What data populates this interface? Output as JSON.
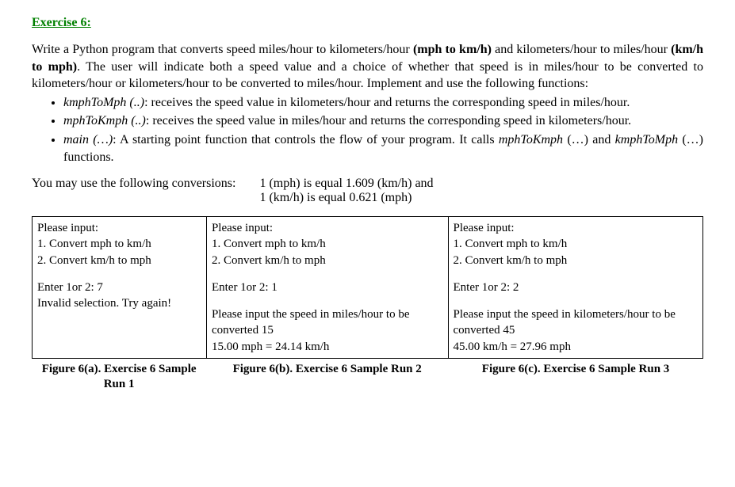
{
  "title": "Exercise 6:",
  "intro_part1": "Write a Python program that converts speed miles/hour to kilometers/hour ",
  "intro_bold1": "(mph to km/h)",
  "intro_part2": " and kilometers/hour to miles/hour ",
  "intro_bold2": "(km/h to mph)",
  "intro_part3": ". The user will indicate both a speed value and a choice of whether that speed is in miles/hour to be converted to kilometers/hour or kilometers/hour to be converted to miles/hour. Implement and use the following functions:",
  "bullets": [
    {
      "name": "kmphToMph (..)",
      "desc": ": receives the speed value in kilometers/hour and returns the corresponding speed in miles/hour."
    },
    {
      "name": "mphToKmph (..)",
      "desc": ": receives the speed value in miles/hour and returns the corresponding speed in kilometers/hour."
    },
    {
      "name": "main (…)",
      "desc_a": ": A starting point function that controls the flow of your program. It calls ",
      "call1": "mphToKmph",
      "desc_b": " (…) and ",
      "call2": "kmphToMph",
      "desc_c": " (…) functions."
    }
  ],
  "conv_label": "You may use the following conversions:",
  "conv_line1": "1 (mph) is equal 1.609 (km/h) and",
  "conv_line2": "1 (km/h) is equal 0.621 (mph)",
  "samples": {
    "a": {
      "l1": "Please input:",
      "l2": "1. Convert mph to km/h",
      "l3": "2. Convert km/h to mph",
      "l4": "Enter 1or 2: 7",
      "l5": "Invalid selection. Try again!"
    },
    "b": {
      "l1": "Please input:",
      "l2": "1. Convert mph to km/h",
      "l3": "2. Convert km/h to mph",
      "l4": "Enter 1or 2: 1",
      "l5": "Please input the speed in miles/hour to be converted  15",
      "l6": "15.00 mph = 24.14 km/h"
    },
    "c": {
      "l1": "Please input:",
      "l2": "1. Convert mph to km/h",
      "l3": "2. Convert km/h to mph",
      "l4": "Enter 1or 2: 2",
      "l5": "Please input the speed in kilometers/hour to be converted  45",
      "l6": "45.00 km/h = 27.96 mph"
    }
  },
  "captions": {
    "a": "Figure 6(a). Exercise 6 Sample Run 1",
    "b": "Figure 6(b). Exercise 6 Sample Run 2",
    "c": "Figure 6(c). Exercise 6 Sample Run 3"
  }
}
